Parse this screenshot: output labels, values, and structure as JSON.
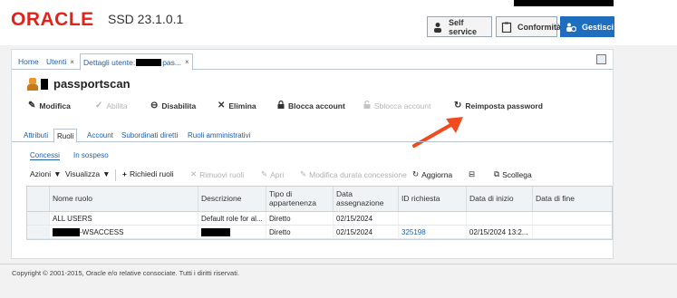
{
  "header": {
    "logo": "ORACLE",
    "version": "SSD 23.1.0.1",
    "buttons": [
      {
        "label": "Self service",
        "icon": "person-icon",
        "active": false
      },
      {
        "label": "Conformità",
        "icon": "clipboard-icon",
        "active": false
      },
      {
        "label": "Gestisci",
        "icon": "users-gear-icon",
        "active": true
      }
    ]
  },
  "tabs": [
    {
      "label": "Home"
    },
    {
      "label": "Utenti",
      "close": "×"
    },
    {
      "label": "Dettagli utente:",
      "suffix": "pas...",
      "close": "×"
    }
  ],
  "user": {
    "name": "passportscan"
  },
  "actions": [
    {
      "label": "Modifica",
      "icon": "pencil-icon",
      "enabled": true
    },
    {
      "label": "Abilita",
      "icon": "check-icon",
      "enabled": false
    },
    {
      "label": "Disabilita",
      "icon": "minus-circle-icon",
      "enabled": true
    },
    {
      "label": "Elimina",
      "icon": "x-icon",
      "enabled": true
    },
    {
      "label": "Blocca account",
      "icon": "lock-icon",
      "enabled": true
    },
    {
      "label": "Sblocca account",
      "icon": "unlock-icon",
      "enabled": false
    },
    {
      "label": "Reimposta password",
      "icon": "reset-icon",
      "enabled": true
    }
  ],
  "subtabs": [
    "Attributi",
    "Ruoli",
    "Account",
    "Subordinati diretti",
    "Ruoli amministrativi"
  ],
  "roletabs": [
    "Concessi",
    "In sospeso"
  ],
  "toolbar": {
    "azioni": "Azioni",
    "visualizza": "Visualizza",
    "richiedi": "Richiedi ruoli",
    "rimuovi": "Rimuovi ruoli",
    "apri": "Apri",
    "modifica_durata": "Modifica durata concessione",
    "aggiorna": "Aggiorna",
    "scollega": "Scollega"
  },
  "table": {
    "columns": [
      "Nome ruolo",
      "Descrizione",
      "Tipo di appartenenza",
      "Data assegnazione",
      "ID richiesta",
      "Data di inizio",
      "Data di fine"
    ],
    "rows": [
      {
        "nome": "ALL USERS",
        "descrizione": "Default role for al...",
        "tipo": "Diretto",
        "data_assegnazione": "02/15/2024",
        "id_richiesta": "",
        "data_inizio": "",
        "data_fine": ""
      },
      {
        "nome": "-WSACCESS",
        "descrizione": "",
        "tipo": "Diretto",
        "data_assegnazione": "02/15/2024",
        "id_richiesta": "325198",
        "data_inizio": "02/15/2024 13:2...",
        "data_fine": ""
      }
    ]
  },
  "footer": "Copyright © 2001-2015, Oracle e/o relative consociate. Tutti i diritti riservati.",
  "colors": {
    "accent": "#1f6dbf",
    "oracle_red": "#e0241b",
    "arrow": "#f04a1e"
  }
}
